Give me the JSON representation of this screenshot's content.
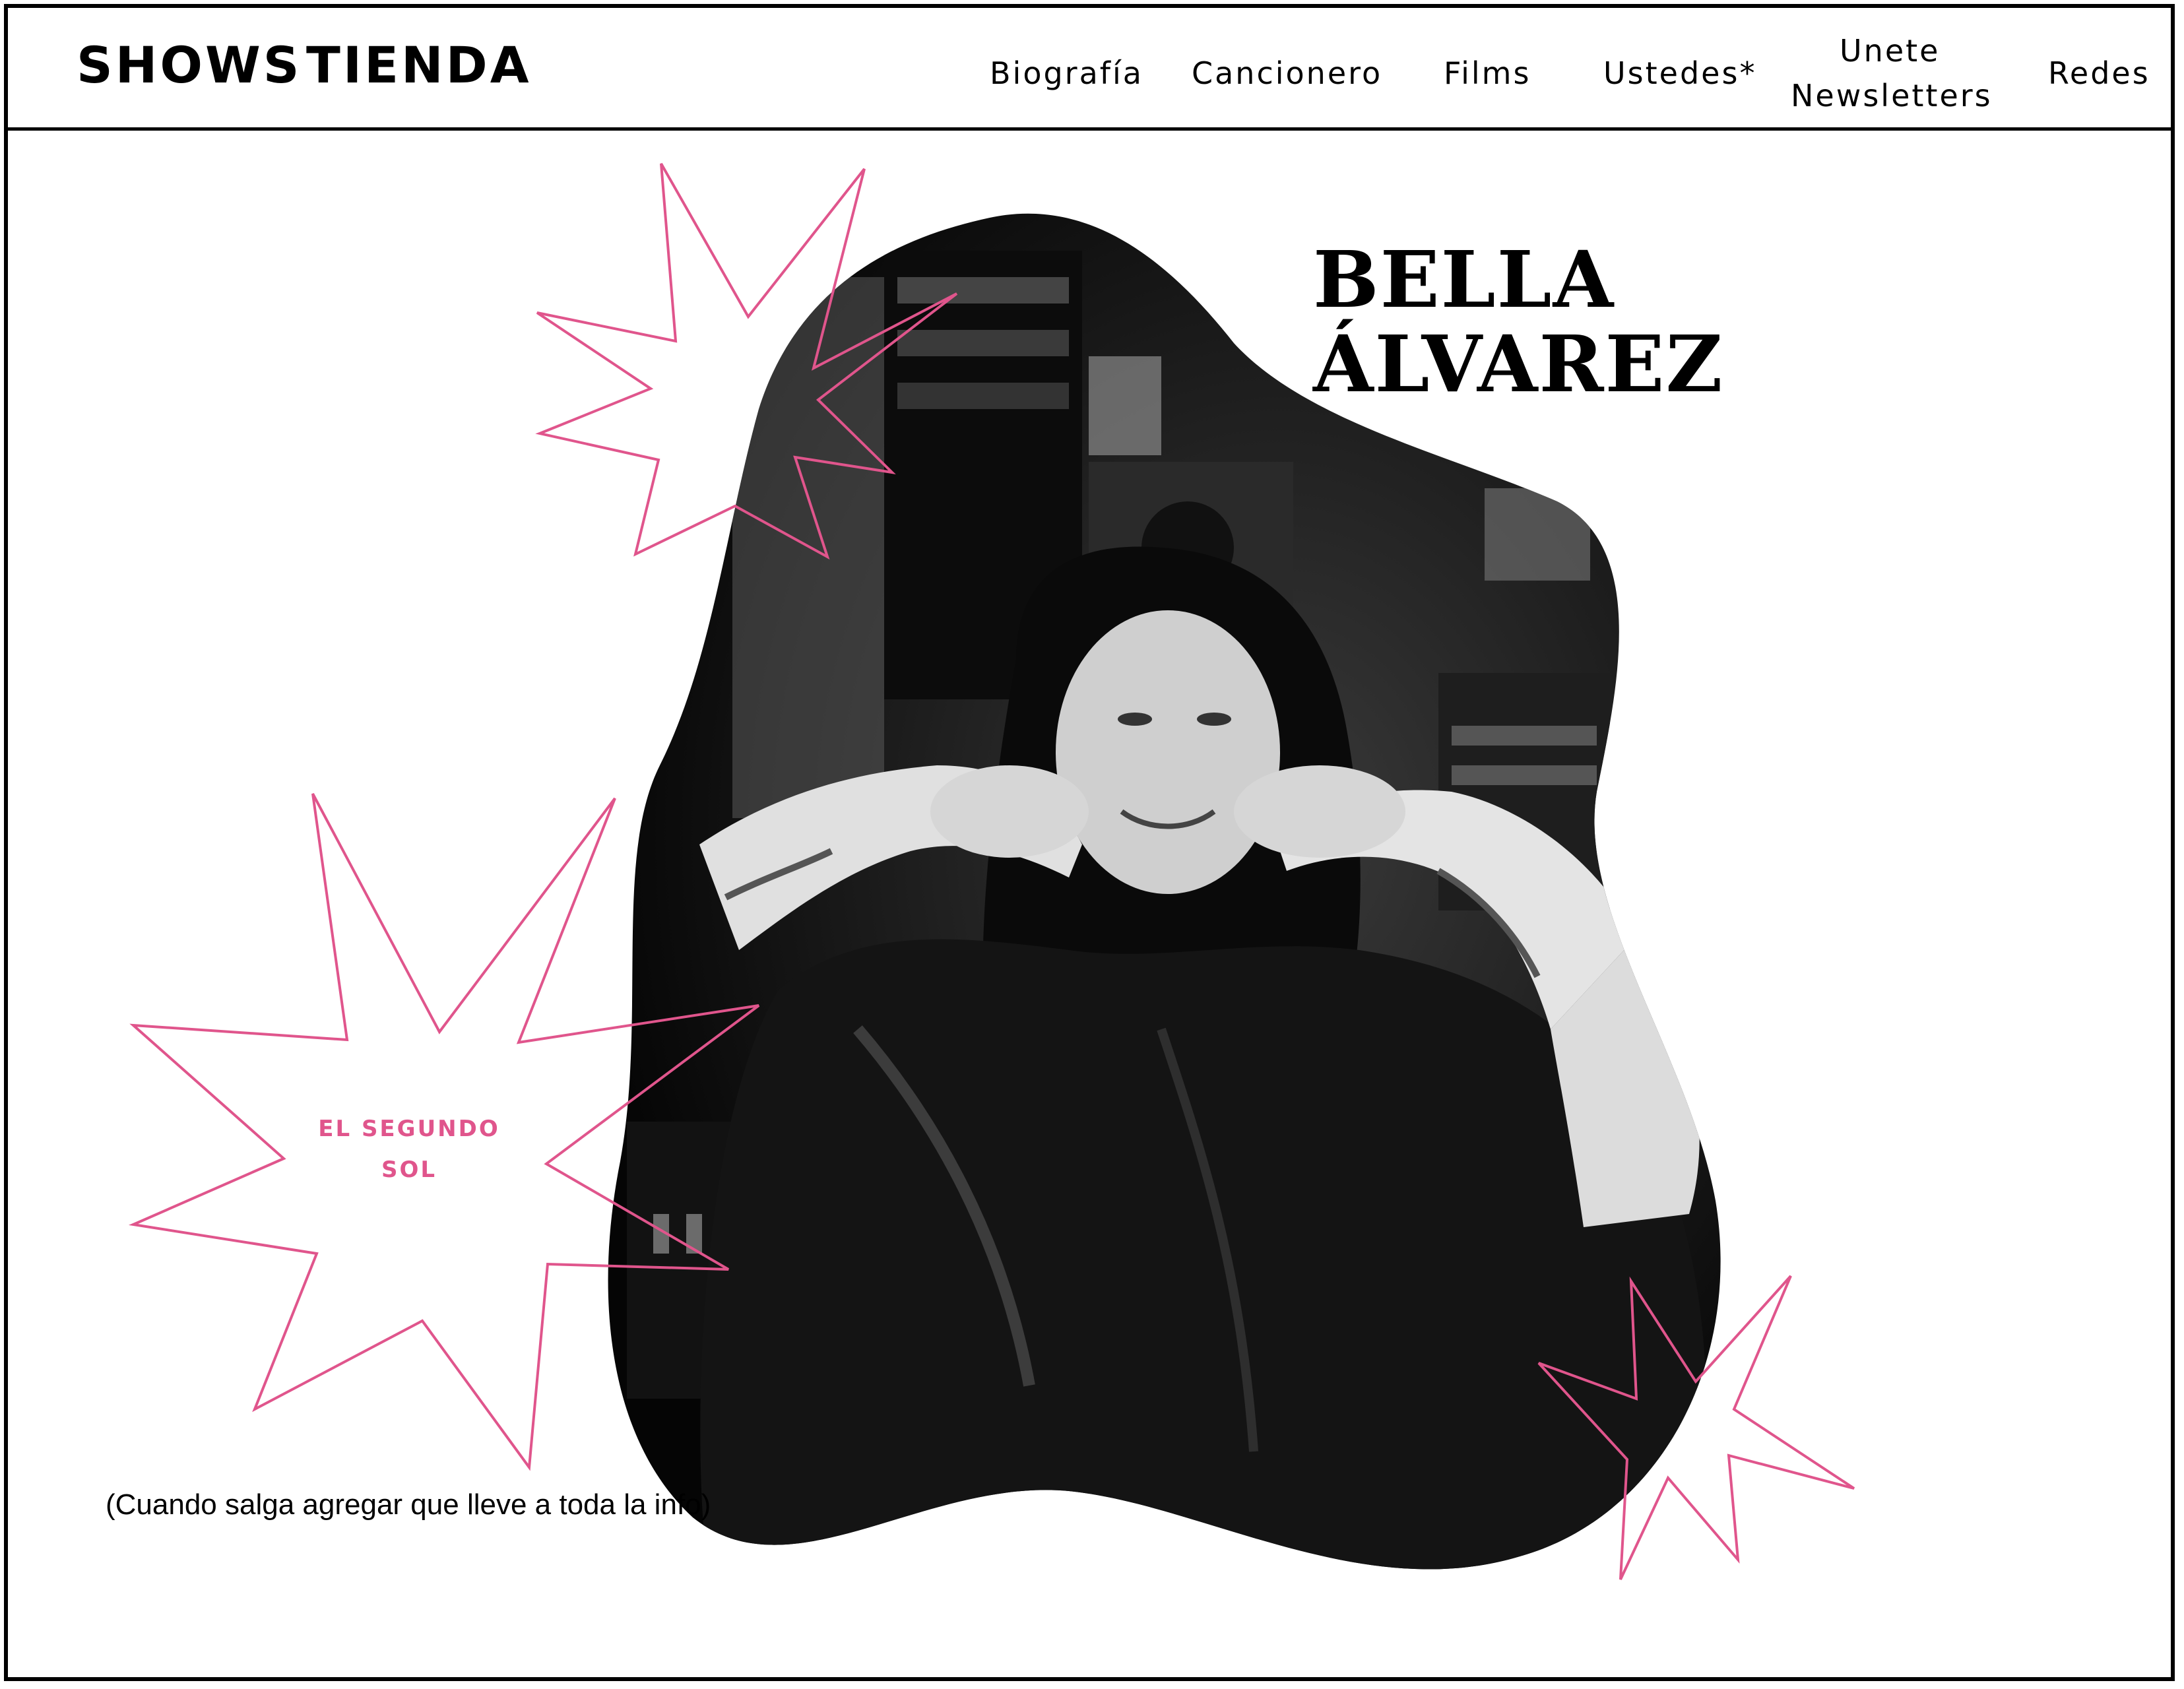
{
  "header": {
    "brand_shows": "SHOWS",
    "brand_tienda": "TIENDA",
    "nav": {
      "biografia": "Biografía",
      "cancionero": "Cancionero",
      "films": "Films",
      "ustedes": "Ustedes*",
      "unete": "Unete",
      "newsletters": "Newsletters",
      "redes": "Redes"
    }
  },
  "hero": {
    "title_line1": "BELLA",
    "title_line2": "ÁLVAREZ",
    "star_label_line1": "EL SEGUNDO",
    "star_label_line2": "SOL",
    "note": "(Cuando salga agregar que lleve a toda la info)"
  },
  "colors": {
    "accent": "#e0558c",
    "text": "#000000",
    "background": "#ffffff"
  },
  "icons": [
    "starburst-icon",
    "starburst-icon",
    "starburst-icon"
  ]
}
